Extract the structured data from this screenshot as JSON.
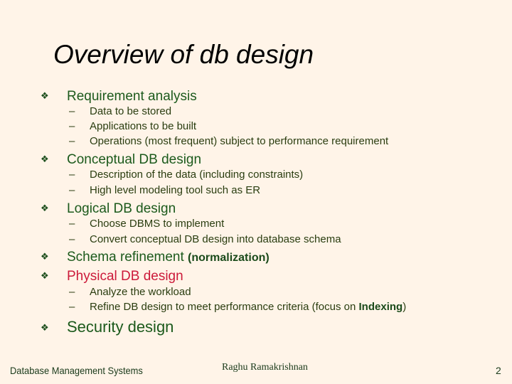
{
  "slide": {
    "title": "Overview of db design",
    "bullet_glyph": "❖",
    "dash_glyph": "–",
    "items": [
      {
        "label": "Requirement analysis",
        "subitems": [
          "Data to be stored",
          "Applications to be built",
          "Operations (most frequent) subject to performance requirement"
        ]
      },
      {
        "label": "Conceptual DB design",
        "subitems": [
          "Description of the data (including constraints)",
          "High level modeling tool such as ER"
        ]
      },
      {
        "label": "Logical DB design",
        "subitems": [
          "Choose DBMS to implement",
          "Convert conceptual DB design into database schema"
        ]
      },
      {
        "label": "Schema refinement ",
        "label_suffix": "(normalization)"
      },
      {
        "label": "Physical DB design",
        "color": "#cc1a3a",
        "subitems": [
          "Analyze the workload",
          "Refine DB design to meet performance criteria (focus on "
        ],
        "subitem_bold": "Indexing",
        "subitem_tail": ")"
      },
      {
        "label": "Security design"
      }
    ]
  },
  "footer": {
    "left": "Database Management Systems",
    "center": "Raghu Ramakrishnan",
    "page_number": "2"
  }
}
